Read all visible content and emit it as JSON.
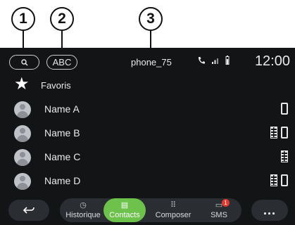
{
  "callouts": [
    "1",
    "2",
    "3"
  ],
  "status_bar": {
    "search_icon": "search-icon",
    "abc_label": "ABC",
    "device_name": "phone_75",
    "time": "12:00"
  },
  "favorites_label": "Favoris",
  "contacts": [
    {
      "name": "Name A",
      "types": [
        "mobile"
      ]
    },
    {
      "name": "Name B",
      "types": [
        "landline",
        "mobile"
      ]
    },
    {
      "name": "Name C",
      "types": [
        "landline"
      ]
    },
    {
      "name": "Name D",
      "types": [
        "landline",
        "mobile"
      ]
    }
  ],
  "nav": {
    "back_icon": "back-arrow-icon",
    "tabs": [
      {
        "label": "Historique",
        "icon": "clock-icon",
        "active": false
      },
      {
        "label": "Contacts",
        "icon": "contacts-icon",
        "active": true
      },
      {
        "label": "Composer",
        "icon": "dialpad-icon",
        "active": false
      },
      {
        "label": "SMS",
        "icon": "message-icon",
        "active": false,
        "badge": "1"
      }
    ],
    "more_label": "..."
  },
  "colors": {
    "screen_bg": "#121416",
    "active_tab": "#6cc24a",
    "badge": "#e03a2f"
  }
}
